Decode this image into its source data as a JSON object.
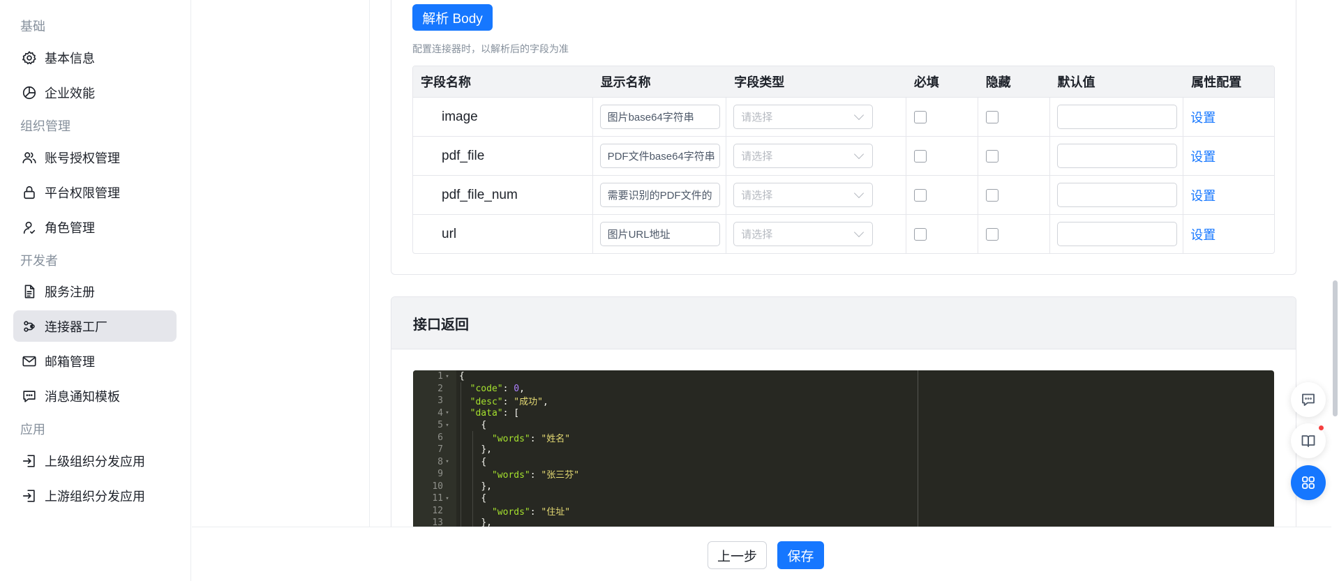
{
  "sidebar": {
    "groups": [
      {
        "title": "基础",
        "items": [
          {
            "label": "基本信息",
            "icon": "gear-icon"
          },
          {
            "label": "企业效能",
            "icon": "pie-chart-icon"
          }
        ]
      },
      {
        "title": "组织管理",
        "items": [
          {
            "label": "账号授权管理",
            "icon": "users-icon"
          },
          {
            "label": "平台权限管理",
            "icon": "lock-icon"
          },
          {
            "label": "角色管理",
            "icon": "user-role-icon"
          }
        ]
      },
      {
        "title": "开发者",
        "items": [
          {
            "label": "服务注册",
            "icon": "document-icon"
          },
          {
            "label": "连接器工厂",
            "icon": "connector-icon"
          },
          {
            "label": "邮箱管理",
            "icon": "mail-icon"
          },
          {
            "label": "消息通知模板",
            "icon": "message-icon"
          }
        ]
      },
      {
        "title": "应用",
        "items": [
          {
            "label": "上级组织分发应用",
            "icon": "enter-icon"
          },
          {
            "label": "上游组织分发应用",
            "icon": "enter-icon"
          }
        ]
      }
    ],
    "active_item": "连接器工厂"
  },
  "params": {
    "parse_button": "解析 Body",
    "hint": "配置连接器时，以解析后的字段为准",
    "columns": [
      "字段名称",
      "显示名称",
      "字段类型",
      "必填",
      "隐藏",
      "默认值",
      "属性配置"
    ],
    "rows": [
      {
        "name": "image",
        "display": "图片base64字符串",
        "type_placeholder": "请选择",
        "default": "",
        "action": "设置"
      },
      {
        "name": "pdf_file",
        "display": "PDF文件base64字符串",
        "type_placeholder": "请选择",
        "default": "",
        "action": "设置"
      },
      {
        "name": "pdf_file_num",
        "display": "需要识别的PDF文件的",
        "type_placeholder": "请选择",
        "default": "",
        "action": "设置"
      },
      {
        "name": "url",
        "display": "图片URL地址",
        "type_placeholder": "请选择",
        "default": "",
        "action": "设置"
      }
    ]
  },
  "response": {
    "title": "接口返回",
    "line_numbers": [
      "1",
      "2",
      "3",
      "4",
      "5",
      "6",
      "7",
      "8",
      "9",
      "10",
      "11",
      "12",
      "13"
    ],
    "code_tokens": {
      "code_key": "\"code\"",
      "code_val": "0",
      "desc_key": "\"desc\"",
      "desc_val": "\"成功\"",
      "data_key": "\"data\"",
      "words_key": "\"words\"",
      "w1": "\"姓名\"",
      "w2": "\"张三芬\"",
      "w3": "\"住址\""
    }
  },
  "footer": {
    "prev_label": "上一步",
    "save_label": "保存"
  },
  "floating": [
    "chat-icon",
    "book-icon",
    "apps-icon"
  ],
  "colors": {
    "primary": "#1677ff",
    "editor_bg": "#272822",
    "active_nav": "#e5e6eb",
    "notification": "#f53f3f"
  }
}
